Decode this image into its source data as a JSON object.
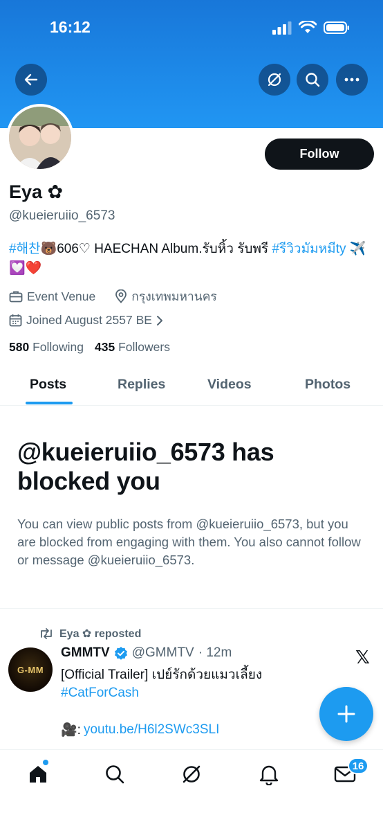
{
  "status_bar": {
    "time": "16:12"
  },
  "profile": {
    "display_name": "Eya ✿",
    "handle": "@kueieruiio_6573",
    "bio_tag1": "#해찬",
    "bio_mid": "🐻606♡ HAECHAN Album.รับหิ้ว รับพรี ",
    "bio_tag2": "#รีวิวมัมหมีty",
    "bio_end": " ✈️💟❤️",
    "category": "Event Venue",
    "location": "กรุงเทพมหานคร",
    "joined": "Joined August 2557 BE",
    "following_count": "580",
    "following_label": "Following",
    "followers_count": "435",
    "followers_label": "Followers",
    "follow_label": "Follow"
  },
  "tabs": [
    "Posts",
    "Replies",
    "Videos",
    "Photos"
  ],
  "blocked": {
    "title": "@kueieruiio_6573 has blocked you",
    "description": "You can view public posts from @kueieruiio_6573, but you are blocked from engaging with them. You also cannot follow or message @kueieruiio_6573."
  },
  "post": {
    "repost_text": "Eya ✿ reposted",
    "author_name": "GMMTV",
    "author_handle": "@GMMTV",
    "time": "· 12m",
    "avatar_text": "G-MM",
    "text_line1": "[Official Trailer] เปย์รักด้วยแมวเลี้ยง",
    "hashtag": "#CatForCash",
    "link_prefix": "🎥:",
    "link": "youtu.be/H6l2SWc3SLI"
  },
  "nav": {
    "messages_badge": "16"
  },
  "colors": {
    "accent": "#1d9bf0",
    "header": "#2196f3",
    "text": "#0f1419",
    "muted": "#536471"
  }
}
